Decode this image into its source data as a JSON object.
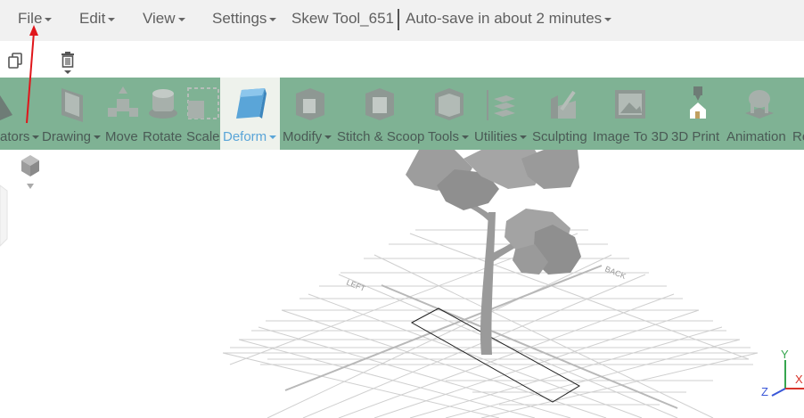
{
  "menu": {
    "file": "File",
    "edit": "Edit",
    "view": "View",
    "settings": "Settings",
    "document_title": "Skew Tool_651",
    "autosave": "Auto-save in about 2 minutes"
  },
  "toolbar": {
    "creators": "ators",
    "drawing": "Drawing",
    "move": "Move",
    "rotate": "Rotate",
    "scale": "Scale",
    "deform": "Deform",
    "modify": "Modify",
    "stitch_scoop": "Stitch & Scoop",
    "tools": "Tools",
    "utilities": "Utilities",
    "sculpting": "Sculpting",
    "image_to_3d": "Image To 3D",
    "print_3d": "3D Print",
    "animation": "Animation",
    "more": "Re"
  },
  "viewport": {
    "grid_label_left": "LEFT",
    "grid_label_right": "BACK",
    "axis_x": "X",
    "axis_y": "Y",
    "axis_z": "Z"
  },
  "colors": {
    "toolbar_bg": "#7fb294",
    "active_bg": "#eef2ec",
    "active_text": "#5aa5d8",
    "arrow": "#e0161b",
    "axis_x": "#d9342b",
    "axis_y": "#36a64f",
    "axis_z": "#3a57d8"
  }
}
